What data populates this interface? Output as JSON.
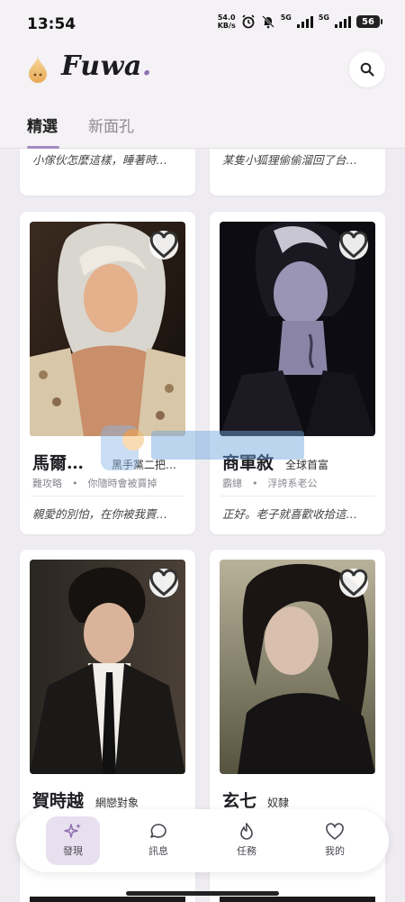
{
  "status_bar": {
    "time": "13:54",
    "speed_value": "54.0",
    "speed_unit": "KB/s",
    "network_1": "5G",
    "network_2": "5G",
    "battery": "56"
  },
  "header": {
    "logo_text": "Fuwa",
    "logo_dot": ".",
    "search_icon": "search-icon"
  },
  "tabs": [
    {
      "label": "精選",
      "active": true
    },
    {
      "label": "新面孔",
      "active": false
    }
  ],
  "feed": {
    "partial_cards": [
      {
        "quote": "小傢伙怎麼這樣，睡著時…"
      },
      {
        "quote": "某隻小狐狸偷偷溜回了台…"
      }
    ],
    "cards": [
      {
        "name": "馬爾…",
        "title": "黑手黨二把…",
        "tags": "難攻略　•　你隨時會被賣掉",
        "quote": "親愛的別怕，在你被我賣…"
      },
      {
        "name": "商軍敘",
        "title": "全球首富",
        "tags": "霸總　•　浮誇系老公",
        "quote": "正好。老子就喜歡收拾這…"
      },
      {
        "name": "賀時越",
        "title": "網戀對象",
        "tags": "",
        "quote": ""
      },
      {
        "name": "玄七",
        "title": "奴隸",
        "tags": "",
        "quote": ""
      }
    ]
  },
  "bottom_nav": [
    {
      "label": "發現",
      "icon": "sparkle-icon",
      "active": true
    },
    {
      "label": "訊息",
      "icon": "chat-bubble-icon",
      "active": false
    },
    {
      "label": "任務",
      "icon": "flame-icon",
      "active": false
    },
    {
      "label": "我的",
      "icon": "heart-icon",
      "active": false
    }
  ],
  "colors": {
    "accent": "#a48bc2",
    "background": "#efecf1",
    "card": "#ffffff"
  }
}
